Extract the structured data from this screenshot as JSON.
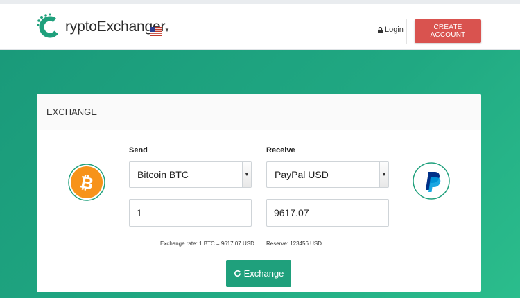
{
  "header": {
    "logo_text": "ryptoExchanger",
    "language_flag": "us-flag",
    "login_label": "Login",
    "login_icon": "lock-icon",
    "create_account_label": "CREATE ACCOUNT"
  },
  "exchange": {
    "title": "EXCHANGE",
    "send": {
      "label": "Send",
      "currency": "Bitcoin BTC",
      "amount": "1",
      "icon": "bitcoin-icon",
      "rate_text": "Exchange rate: 1 BTC = 9617.07 USD"
    },
    "receive": {
      "label": "Receive",
      "currency": "PayPal USD",
      "amount": "9617.07",
      "icon": "paypal-icon",
      "reserve_text": "Reserve: 123456 USD"
    },
    "submit_label": "Exchange",
    "submit_icon": "refresh-icon"
  },
  "colors": {
    "brand_green": "#1fa07c",
    "create_account_red": "#d9534f",
    "bitcoin_orange": "#f7931a",
    "paypal_blue": "#003087"
  }
}
